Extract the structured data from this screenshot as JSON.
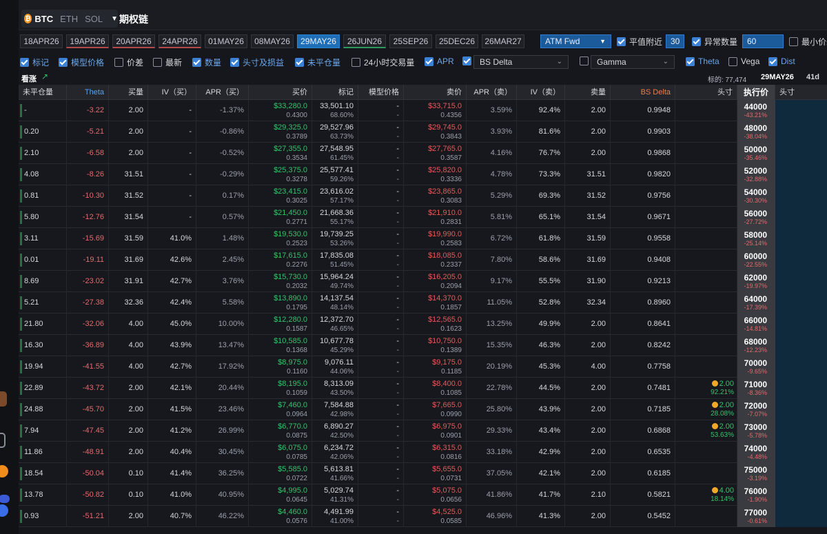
{
  "coins": [
    "BTC",
    "ETH",
    "SOL"
  ],
  "active_coin": "BTC",
  "page_title": "期权链",
  "expiries": [
    "18APR26",
    "19APR26",
    "20APR26",
    "24APR26",
    "01MAY26",
    "08MAY26",
    "29MAY26",
    "26JUN26",
    "25SEP26",
    "25DEC26",
    "26MAR27"
  ],
  "selected_expiry": "29MAY26",
  "atm_mode": "ATM Fwd",
  "near_atm": {
    "label": "平值附近",
    "checked": true,
    "value": "30"
  },
  "abnormal_qty": {
    "label": "异常数量",
    "checked": true,
    "value": "60"
  },
  "min_price": {
    "label": "最小价差",
    "checked": false
  },
  "filters": [
    {
      "label": "标记",
      "checked": true
    },
    {
      "label": "模型价格",
      "checked": true
    },
    {
      "label": "价差",
      "checked": false
    },
    {
      "label": "最新",
      "checked": false
    },
    {
      "label": "数量",
      "checked": true
    },
    {
      "label": "头寸及损益",
      "checked": true
    },
    {
      "label": "未平仓量",
      "checked": true
    },
    {
      "label": "24小时交易量",
      "checked": false
    },
    {
      "label": "APR",
      "checked": true
    }
  ],
  "delta_select": {
    "value": "BS Delta",
    "checked": true
  },
  "gamma_select": {
    "value": "Gamma",
    "checked": false
  },
  "greek_toggles": [
    {
      "label": "Theta",
      "checked": true
    },
    {
      "label": "Vega",
      "checked": false
    },
    {
      "label": "Dist",
      "checked": true
    }
  ],
  "section": {
    "label": "看涨",
    "underlying": "标的: 77,474",
    "expiry": "29MAY26",
    "days": "41d"
  },
  "headers": {
    "oi": "未平仓量",
    "theta": "Theta",
    "bid_qty": "买量",
    "iv_bid": "IV（买）",
    "apr_bid": "APR（买）",
    "bid": "买价",
    "mark": "标记",
    "model": "模型价格",
    "ask": "卖价",
    "apr_ask": "APR（卖）",
    "iv_ask": "IV（卖）",
    "ask_qty": "卖量",
    "delta": "BS Delta",
    "position": "头寸",
    "strike": "执行价",
    "put_position": "头寸"
  },
  "rows": [
    {
      "oi": "-",
      "theta": "-3.22",
      "bid_qty": "2.00",
      "iv_bid": "-",
      "apr_bid": "-1.37%",
      "bid": "$33,280.0",
      "bid_sub": "0.4300",
      "mark": "33,501.10",
      "mark_sub": "68.60%",
      "model": "-",
      "model_sub": "-",
      "ask": "$33,715.0",
      "ask_sub": "0.4356",
      "apr_ask": "3.59%",
      "iv_ask": "92.4%",
      "ask_qty": "2.00",
      "delta": "0.9948",
      "pos": "",
      "pos_sub": "",
      "strike": "44000",
      "strike_pct": "-43.21%"
    },
    {
      "oi": "0.20",
      "theta": "-5.21",
      "bid_qty": "2.00",
      "iv_bid": "-",
      "apr_bid": "-0.86%",
      "bid": "$29,325.0",
      "bid_sub": "0.3789",
      "mark": "29,527.96",
      "mark_sub": "63.73%",
      "model": "-",
      "model_sub": "-",
      "ask": "$29,745.0",
      "ask_sub": "0.3843",
      "apr_ask": "3.93%",
      "iv_ask": "81.6%",
      "ask_qty": "2.00",
      "delta": "0.9903",
      "pos": "",
      "pos_sub": "",
      "strike": "48000",
      "strike_pct": "-38.04%"
    },
    {
      "oi": "2.10",
      "theta": "-6.58",
      "bid_qty": "2.00",
      "iv_bid": "-",
      "apr_bid": "-0.52%",
      "bid": "$27,355.0",
      "bid_sub": "0.3534",
      "mark": "27,548.95",
      "mark_sub": "61.45%",
      "model": "-",
      "model_sub": "-",
      "ask": "$27,765.0",
      "ask_sub": "0.3587",
      "apr_ask": "4.16%",
      "iv_ask": "76.7%",
      "ask_qty": "2.00",
      "delta": "0.9868",
      "pos": "",
      "pos_sub": "",
      "strike": "50000",
      "strike_pct": "-35.46%"
    },
    {
      "oi": "4.08",
      "theta": "-8.26",
      "bid_qty": "31.51",
      "iv_bid": "-",
      "apr_bid": "-0.29%",
      "bid": "$25,375.0",
      "bid_sub": "0.3278",
      "mark": "25,577.41",
      "mark_sub": "59.26%",
      "model": "-",
      "model_sub": "-",
      "ask": "$25,820.0",
      "ask_sub": "0.3336",
      "apr_ask": "4.78%",
      "iv_ask": "73.3%",
      "ask_qty": "31.51",
      "delta": "0.9820",
      "pos": "",
      "pos_sub": "",
      "strike": "52000",
      "strike_pct": "-32.88%"
    },
    {
      "oi": "0.81",
      "theta": "-10.30",
      "bid_qty": "31.52",
      "iv_bid": "-",
      "apr_bid": "0.17%",
      "bid": "$23,415.0",
      "bid_sub": "0.3025",
      "mark": "23,616.02",
      "mark_sub": "57.17%",
      "model": "-",
      "model_sub": "-",
      "ask": "$23,865.0",
      "ask_sub": "0.3083",
      "apr_ask": "5.29%",
      "iv_ask": "69.3%",
      "ask_qty": "31.52",
      "delta": "0.9756",
      "pos": "",
      "pos_sub": "",
      "strike": "54000",
      "strike_pct": "-30.30%"
    },
    {
      "oi": "5.80",
      "theta": "-12.76",
      "bid_qty": "31.54",
      "iv_bid": "-",
      "apr_bid": "0.57%",
      "bid": "$21,450.0",
      "bid_sub": "0.2771",
      "mark": "21,668.36",
      "mark_sub": "55.17%",
      "model": "-",
      "model_sub": "-",
      "ask": "$21,910.0",
      "ask_sub": "0.2831",
      "apr_ask": "5.81%",
      "iv_ask": "65.1%",
      "ask_qty": "31.54",
      "delta": "0.9671",
      "pos": "",
      "pos_sub": "",
      "strike": "56000",
      "strike_pct": "-27.72%"
    },
    {
      "oi": "3.11",
      "theta": "-15.69",
      "bid_qty": "31.59",
      "iv_bid": "41.0%",
      "apr_bid": "1.48%",
      "bid": "$19,530.0",
      "bid_sub": "0.2523",
      "mark": "19,739.25",
      "mark_sub": "53.26%",
      "model": "-",
      "model_sub": "-",
      "ask": "$19,990.0",
      "ask_sub": "0.2583",
      "apr_ask": "6.72%",
      "iv_ask": "61.8%",
      "ask_qty": "31.59",
      "delta": "0.9558",
      "pos": "",
      "pos_sub": "",
      "strike": "58000",
      "strike_pct": "-25.14%"
    },
    {
      "oi": "0.01",
      "theta": "-19.11",
      "bid_qty": "31.69",
      "iv_bid": "42.6%",
      "apr_bid": "2.45%",
      "bid": "$17,615.0",
      "bid_sub": "0.2276",
      "mark": "17,835.08",
      "mark_sub": "51.45%",
      "model": "-",
      "model_sub": "-",
      "ask": "$18,085.0",
      "ask_sub": "0.2337",
      "apr_ask": "7.80%",
      "iv_ask": "58.6%",
      "ask_qty": "31.69",
      "delta": "0.9408",
      "pos": "",
      "pos_sub": "",
      "strike": "60000",
      "strike_pct": "-22.55%"
    },
    {
      "oi": "8.69",
      "theta": "-23.02",
      "bid_qty": "31.91",
      "iv_bid": "42.7%",
      "apr_bid": "3.76%",
      "bid": "$15,730.0",
      "bid_sub": "0.2032",
      "mark": "15,964.24",
      "mark_sub": "49.74%",
      "model": "-",
      "model_sub": "-",
      "ask": "$16,205.0",
      "ask_sub": "0.2094",
      "apr_ask": "9.17%",
      "iv_ask": "55.5%",
      "ask_qty": "31.90",
      "delta": "0.9213",
      "pos": "",
      "pos_sub": "",
      "strike": "62000",
      "strike_pct": "-19.97%"
    },
    {
      "oi": "5.21",
      "theta": "-27.38",
      "bid_qty": "32.36",
      "iv_bid": "42.4%",
      "apr_bid": "5.58%",
      "bid": "$13,890.0",
      "bid_sub": "0.1795",
      "mark": "14,137.54",
      "mark_sub": "48.14%",
      "model": "-",
      "model_sub": "-",
      "ask": "$14,370.0",
      "ask_sub": "0.1857",
      "apr_ask": "11.05%",
      "iv_ask": "52.8%",
      "ask_qty": "32.34",
      "delta": "0.8960",
      "pos": "",
      "pos_sub": "",
      "strike": "64000",
      "strike_pct": "-17.39%"
    },
    {
      "oi": "21.80",
      "theta": "-32.06",
      "bid_qty": "4.00",
      "iv_bid": "45.0%",
      "apr_bid": "10.00%",
      "bid": "$12,280.0",
      "bid_sub": "0.1587",
      "mark": "12,372.70",
      "mark_sub": "46.65%",
      "model": "-",
      "model_sub": "-",
      "ask": "$12,565.0",
      "ask_sub": "0.1623",
      "apr_ask": "13.25%",
      "iv_ask": "49.9%",
      "ask_qty": "2.00",
      "delta": "0.8641",
      "pos": "",
      "pos_sub": "",
      "strike": "66000",
      "strike_pct": "-14.81%"
    },
    {
      "oi": "16.30",
      "theta": "-36.89",
      "bid_qty": "4.00",
      "iv_bid": "43.9%",
      "apr_bid": "13.47%",
      "bid": "$10,585.0",
      "bid_sub": "0.1368",
      "mark": "10,677.78",
      "mark_sub": "45.29%",
      "model": "-",
      "model_sub": "-",
      "ask": "$10,750.0",
      "ask_sub": "0.1389",
      "apr_ask": "15.35%",
      "iv_ask": "46.3%",
      "ask_qty": "2.00",
      "delta": "0.8242",
      "pos": "",
      "pos_sub": "",
      "strike": "68000",
      "strike_pct": "-12.23%"
    },
    {
      "oi": "19.94",
      "theta": "-41.55",
      "bid_qty": "4.00",
      "iv_bid": "42.7%",
      "apr_bid": "17.92%",
      "bid": "$8,975.0",
      "bid_sub": "0.1160",
      "mark": "9,076.11",
      "mark_sub": "44.06%",
      "model": "-",
      "model_sub": "-",
      "ask": "$9,175.0",
      "ask_sub": "0.1185",
      "apr_ask": "20.19%",
      "iv_ask": "45.3%",
      "ask_qty": "4.00",
      "delta": "0.7758",
      "pos": "",
      "pos_sub": "",
      "strike": "70000",
      "strike_pct": "-9.65%"
    },
    {
      "oi": "22.89",
      "theta": "-43.72",
      "bid_qty": "2.00",
      "iv_bid": "42.1%",
      "apr_bid": "20.44%",
      "bid": "$8,195.0",
      "bid_sub": "0.1059",
      "mark": "8,313.09",
      "mark_sub": "43.50%",
      "model": "-",
      "model_sub": "-",
      "ask": "$8,400.0",
      "ask_sub": "0.1085",
      "apr_ask": "22.78%",
      "iv_ask": "44.5%",
      "ask_qty": "2.00",
      "delta": "0.7481",
      "pos": "2.00",
      "pos_sub": "92.21%",
      "strike": "71000",
      "strike_pct": "-8.36%"
    },
    {
      "oi": "24.88",
      "theta": "-45.70",
      "bid_qty": "2.00",
      "iv_bid": "41.5%",
      "apr_bid": "23.46%",
      "bid": "$7,460.0",
      "bid_sub": "0.0964",
      "mark": "7,584.88",
      "mark_sub": "42.98%",
      "model": "-",
      "model_sub": "-",
      "ask": "$7,665.0",
      "ask_sub": "0.0990",
      "apr_ask": "25.80%",
      "iv_ask": "43.9%",
      "ask_qty": "2.00",
      "delta": "0.7185",
      "pos": "2.00",
      "pos_sub": "28.08%",
      "strike": "72000",
      "strike_pct": "-7.07%"
    },
    {
      "oi": "7.94",
      "theta": "-47.45",
      "bid_qty": "2.00",
      "iv_bid": "41.2%",
      "apr_bid": "26.99%",
      "bid": "$6,770.0",
      "bid_sub": "0.0875",
      "mark": "6,890.27",
      "mark_sub": "42.50%",
      "model": "-",
      "model_sub": "-",
      "ask": "$6,975.0",
      "ask_sub": "0.0901",
      "apr_ask": "29.33%",
      "iv_ask": "43.4%",
      "ask_qty": "2.00",
      "delta": "0.6868",
      "pos": "2.00",
      "pos_sub": "53.63%",
      "strike": "73000",
      "strike_pct": "-5.78%"
    },
    {
      "oi": "11.86",
      "theta": "-48.91",
      "bid_qty": "2.00",
      "iv_bid": "40.4%",
      "apr_bid": "30.45%",
      "bid": "$6,075.0",
      "bid_sub": "0.0785",
      "mark": "6,234.72",
      "mark_sub": "42.06%",
      "model": "-",
      "model_sub": "-",
      "ask": "$6,315.0",
      "ask_sub": "0.0816",
      "apr_ask": "33.18%",
      "iv_ask": "42.9%",
      "ask_qty": "2.00",
      "delta": "0.6535",
      "pos": "",
      "pos_sub": "",
      "strike": "74000",
      "strike_pct": "-4.48%"
    },
    {
      "oi": "18.54",
      "theta": "-50.04",
      "bid_qty": "0.10",
      "iv_bid": "41.4%",
      "apr_bid": "36.25%",
      "bid": "$5,585.0",
      "bid_sub": "0.0722",
      "mark": "5,613.81",
      "mark_sub": "41.66%",
      "model": "-",
      "model_sub": "-",
      "ask": "$5,655.0",
      "ask_sub": "0.0731",
      "apr_ask": "37.05%",
      "iv_ask": "42.1%",
      "ask_qty": "2.00",
      "delta": "0.6185",
      "pos": "",
      "pos_sub": "",
      "strike": "75000",
      "strike_pct": "-3.19%"
    },
    {
      "oi": "13.78",
      "theta": "-50.82",
      "bid_qty": "0.10",
      "iv_bid": "41.0%",
      "apr_bid": "40.95%",
      "bid": "$4,995.0",
      "bid_sub": "0.0645",
      "mark": "5,029.74",
      "mark_sub": "41.31%",
      "model": "-",
      "model_sub": "-",
      "ask": "$5,075.0",
      "ask_sub": "0.0656",
      "apr_ask": "41.86%",
      "iv_ask": "41.7%",
      "ask_qty": "2.10",
      "delta": "0.5821",
      "pos": "4.00",
      "pos_sub": "18.14%",
      "strike": "76000",
      "strike_pct": "-1.90%"
    },
    {
      "oi": "0.93",
      "theta": "-51.21",
      "bid_qty": "2.00",
      "iv_bid": "40.7%",
      "apr_bid": "46.22%",
      "bid": "$4,460.0",
      "bid_sub": "0.0576",
      "mark": "4,491.99",
      "mark_sub": "41.00%",
      "model": "-",
      "model_sub": "-",
      "ask": "$4,525.0",
      "ask_sub": "0.0585",
      "apr_ask": "46.96%",
      "iv_ask": "41.3%",
      "ask_qty": "2.00",
      "delta": "0.5452",
      "pos": "",
      "pos_sub": "",
      "strike": "77000",
      "strike_pct": "-0.61%"
    }
  ]
}
